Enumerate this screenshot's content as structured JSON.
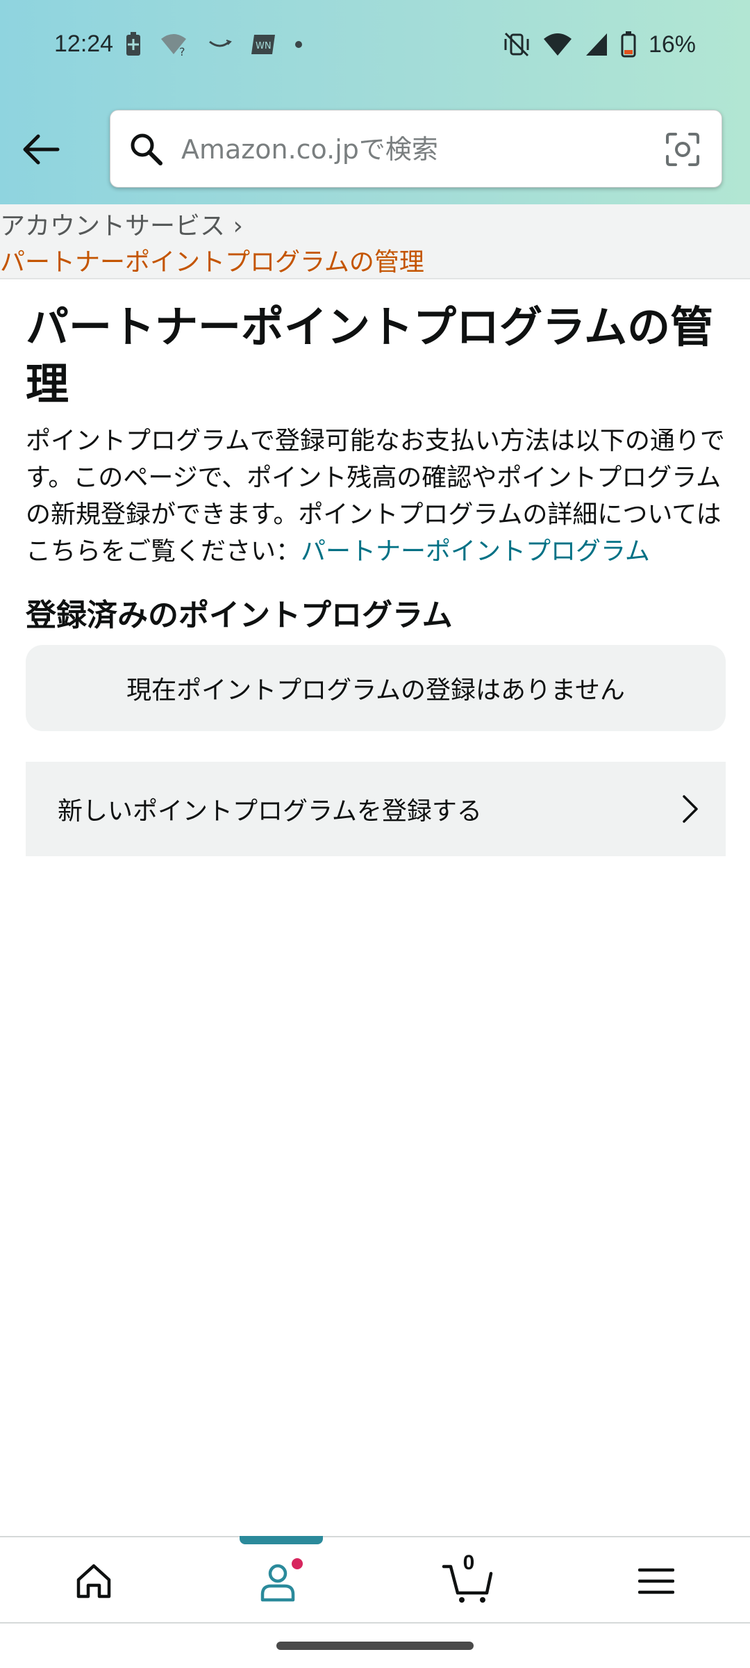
{
  "status_bar": {
    "time": "12:24",
    "battery_percent": "16%"
  },
  "search": {
    "placeholder": "Amazon.co.jpで検索"
  },
  "breadcrumb": {
    "parent": "アカウントサービス ›",
    "current": "パートナーポイントプログラムの管理"
  },
  "main": {
    "title": "パートナーポイントプログラムの管理",
    "description": "ポイントプログラムで登録可能なお支払い方法は以下の通りです。このページで、ポイント残高の確認やポイントプログラムの新規登録ができます。ポイントプログラムの詳細についてはこちらをご覧ください：",
    "description_link": "パートナーポイントプログラム",
    "registered_heading": "登録済みのポイントプログラム",
    "empty_message": "現在ポイントプログラムの登録はありません",
    "register_new_label": "新しいポイントプログラムを登録する"
  },
  "bottom_nav": {
    "items": [
      {
        "icon": "home-icon"
      },
      {
        "icon": "account-icon",
        "active": true,
        "has_notification": true
      },
      {
        "icon": "cart-icon",
        "count": "0"
      },
      {
        "icon": "menu-icon"
      }
    ]
  },
  "colors": {
    "breadcrumb_current": "#c45500",
    "link": "#007185",
    "active_tab": "#2b8a9b",
    "notification_dot": "#d7265e"
  }
}
